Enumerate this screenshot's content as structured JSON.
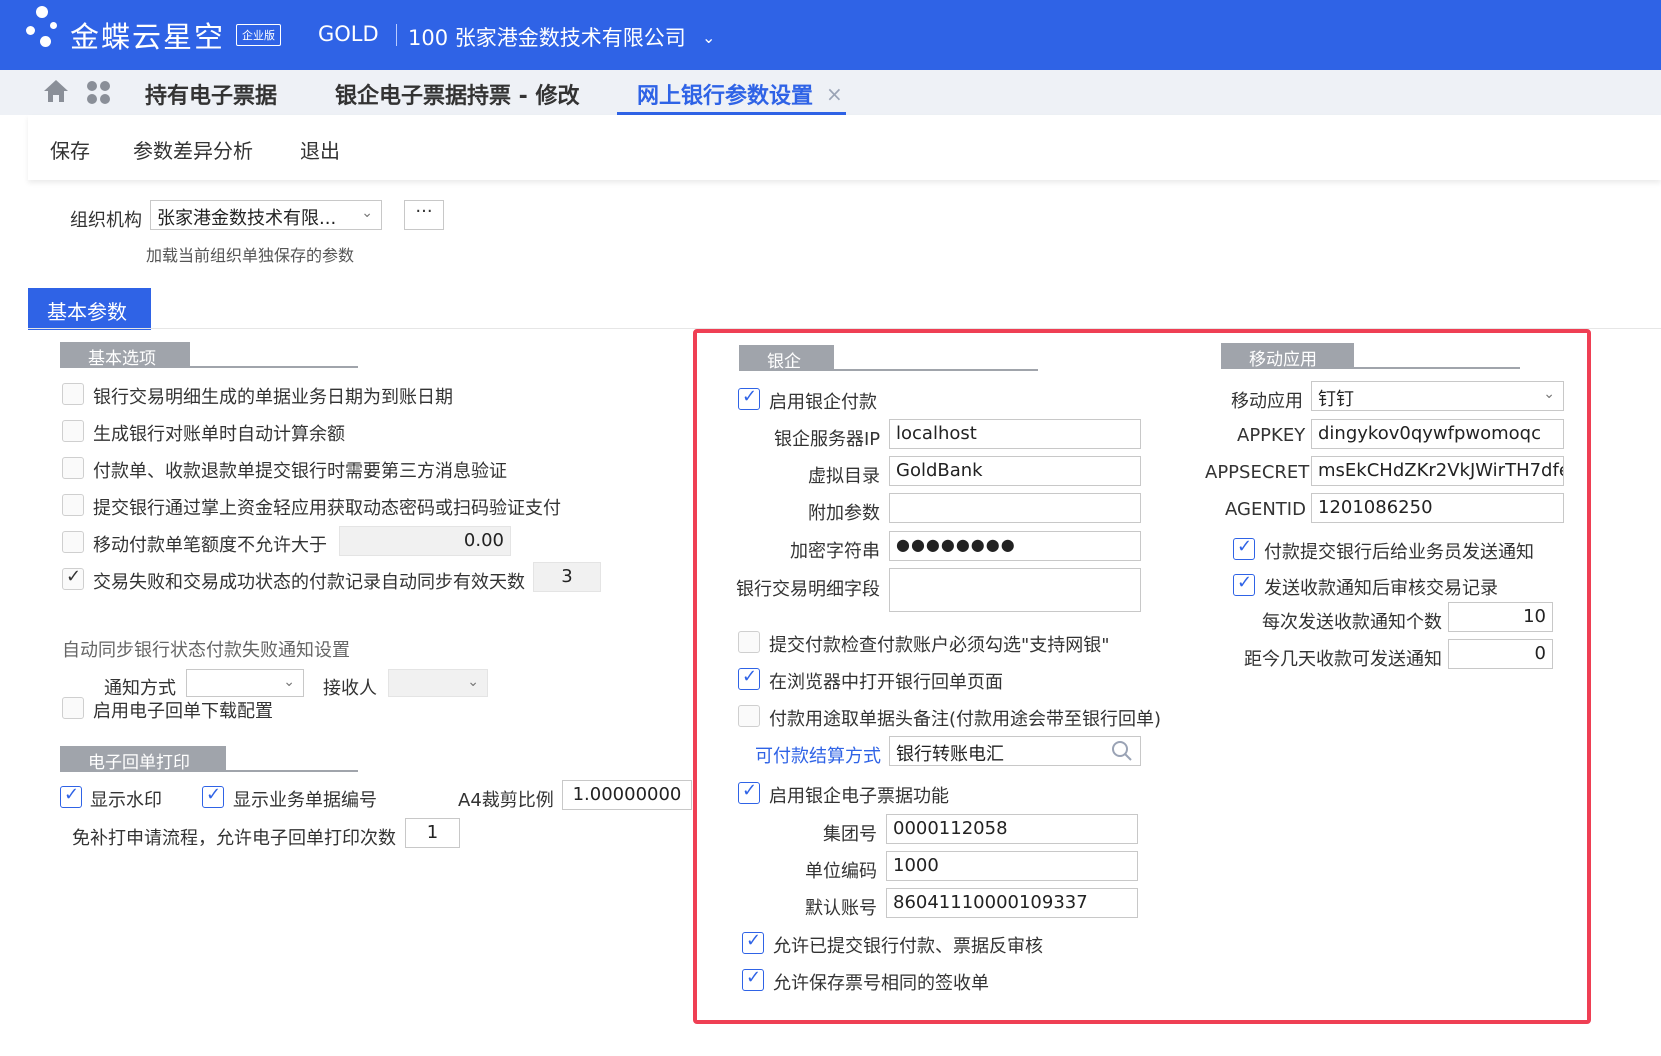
{
  "header": {
    "brand": "金蝶云星空",
    "edition": "企业版",
    "user": "GOLD",
    "org": "100 张家港金数技术有限公司"
  },
  "tabs": [
    {
      "label": "持有电子票据"
    },
    {
      "label": "银企电子票据持票 - 修改"
    },
    {
      "label": "网上银行参数设置"
    }
  ],
  "toolbar": {
    "save": "保存",
    "diff": "参数差异分析",
    "exit": "退出"
  },
  "org_row": {
    "label": "组织机构",
    "value": "张家港金数技术有限...",
    "hint": "加载当前组织单独保存的参数"
  },
  "basic_tab": "基本参数",
  "basic_options": {
    "title": "基本选项",
    "items": [
      {
        "label": "银行交易明细生成的单据业务日期为到账日期",
        "checked": false
      },
      {
        "label": "生成银行对账单时自动计算余额",
        "checked": false
      },
      {
        "label": "付款单、收款退款单提交银行时需要第三方消息验证",
        "checked": false
      },
      {
        "label": "提交银行通过掌上资金轻应用获取动态密码或扫码验证支付",
        "checked": false
      },
      {
        "label": "移动付款单笔额度不允许大于",
        "checked": false,
        "value": "0.00"
      },
      {
        "label": "交易失败和交易成功状态的付款记录自动同步有效天数",
        "checked": true,
        "value": "3"
      }
    ],
    "sync_title": "自动同步银行状态付款失败通知设置",
    "notify_label": "通知方式",
    "receiver_label": "接收人",
    "ereceipt_download": "启用电子回单下载配置"
  },
  "ereceipt_print": {
    "title": "电子回单打印",
    "show_watermark": "显示水印",
    "show_bill_no": "显示业务单据编号",
    "a4_label": "A4裁剪比例",
    "a4_value": "1.00000000",
    "reprint_label": "免补打申请流程，允许电子回单打印次数",
    "reprint_value": "1"
  },
  "bank_enterprise": {
    "title": "银企",
    "enable_pay": "启用银企付款",
    "server_ip_label": "银企服务器IP",
    "server_ip": "localhost",
    "vdir_label": "虚拟目录",
    "vdir": "GoldBank",
    "extra_label": "附加参数",
    "extra": "",
    "encrypt_label": "加密字符串",
    "encrypt": "●●●●●●●●",
    "detail_label": "银行交易明细字段",
    "check_online": "提交付款检查付款账户必须勾选\"支持网银\"",
    "open_browser": "在浏览器中打开银行回单页面",
    "use_remark": "付款用途取单据头备注(付款用途会带至银行回单)",
    "settle_label": "可付款结算方式",
    "settle_value": "银行转账电汇",
    "enable_ebill": "启用银企电子票据功能",
    "group_label": "集团号",
    "group": "0000112058",
    "unit_label": "单位编码",
    "unit": "1000",
    "account_label": "默认账号",
    "account": "86041110000109337",
    "allow_reverse": "允许已提交银行付款、票据反审核",
    "allow_same": "允许保存票号相同的签收单"
  },
  "mobile": {
    "title": "移动应用",
    "app_label": "移动应用",
    "app_value": "钉钉",
    "appkey_label": "APPKEY",
    "appkey": "dingykov0qywfpwomoqc",
    "secret_label": "APPSECRET",
    "secret": "msEkCHdZKr2VkJWirTH7dfe",
    "agent_label": "AGENTID",
    "agent": "1201086250",
    "notify_after_submit": "付款提交银行后给业务员发送通知",
    "audit_after_notify": "发送收款通知后审核交易记录",
    "per_send_label": "每次发送收款通知个数",
    "per_send": "10",
    "days_label": "距今几天收款可发送通知",
    "days": "0"
  },
  "colors": {
    "brand_blue": "#2f63e6",
    "highlight_red": "#ef3f54",
    "section_gray": "#a0a4ab"
  }
}
